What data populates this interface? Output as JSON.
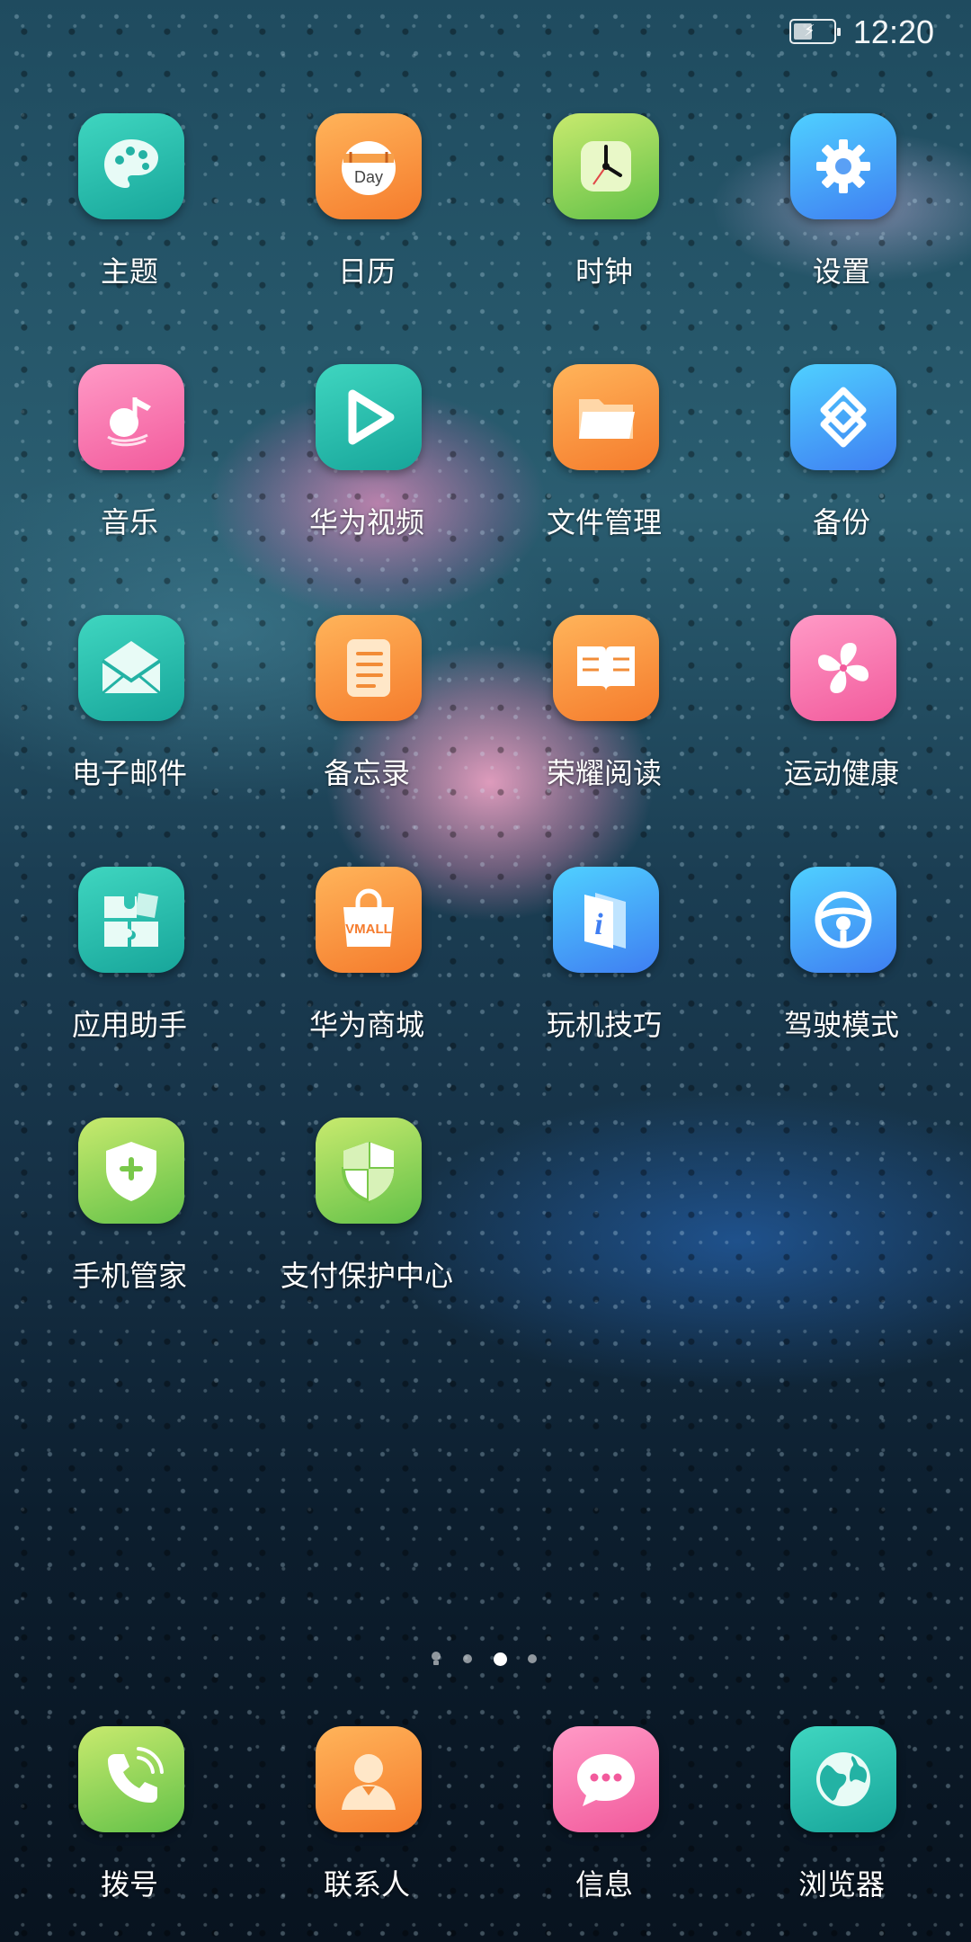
{
  "status_bar": {
    "time": "12:20",
    "battery_icon": "battery-charging-icon"
  },
  "apps": [
    {
      "label": "主题",
      "icon": "palette-icon"
    },
    {
      "label": "日历",
      "icon": "calendar-icon",
      "icon_text": "Day"
    },
    {
      "label": "时钟",
      "icon": "clock-icon"
    },
    {
      "label": "设置",
      "icon": "gear-icon"
    },
    {
      "label": "音乐",
      "icon": "music-note-icon"
    },
    {
      "label": "华为视频",
      "icon": "video-play-icon"
    },
    {
      "label": "文件管理",
      "icon": "folder-icon"
    },
    {
      "label": "备份",
      "icon": "backup-icon"
    },
    {
      "label": "电子邮件",
      "icon": "envelope-icon"
    },
    {
      "label": "备忘录",
      "icon": "notepad-icon"
    },
    {
      "label": "荣耀阅读",
      "icon": "book-icon"
    },
    {
      "label": "运动健康",
      "icon": "pinwheel-icon"
    },
    {
      "label": "应用助手",
      "icon": "puzzle-icon"
    },
    {
      "label": "华为商城",
      "icon": "shopping-bag-icon",
      "icon_text": "VMALL"
    },
    {
      "label": "玩机技巧",
      "icon": "info-icon",
      "icon_text": "i"
    },
    {
      "label": "驾驶模式",
      "icon": "steering-wheel-icon"
    },
    {
      "label": "手机管家",
      "icon": "shield-plus-icon"
    },
    {
      "label": "支付保护中心",
      "icon": "shield-icon"
    }
  ],
  "dock": [
    {
      "label": "拨号",
      "icon": "phone-icon"
    },
    {
      "label": "联系人",
      "icon": "contact-icon"
    },
    {
      "label": "信息",
      "icon": "message-icon"
    },
    {
      "label": "浏览器",
      "icon": "globe-icon"
    }
  ],
  "pager": {
    "page_count": 3,
    "current_page": 2,
    "hint_icon": "bulb-icon"
  },
  "colors": {
    "teal": "#17a59a",
    "orange": "#f57b2c",
    "green": "#62c148",
    "blue": "#3f7ef2",
    "pink": "#f25a9c"
  }
}
